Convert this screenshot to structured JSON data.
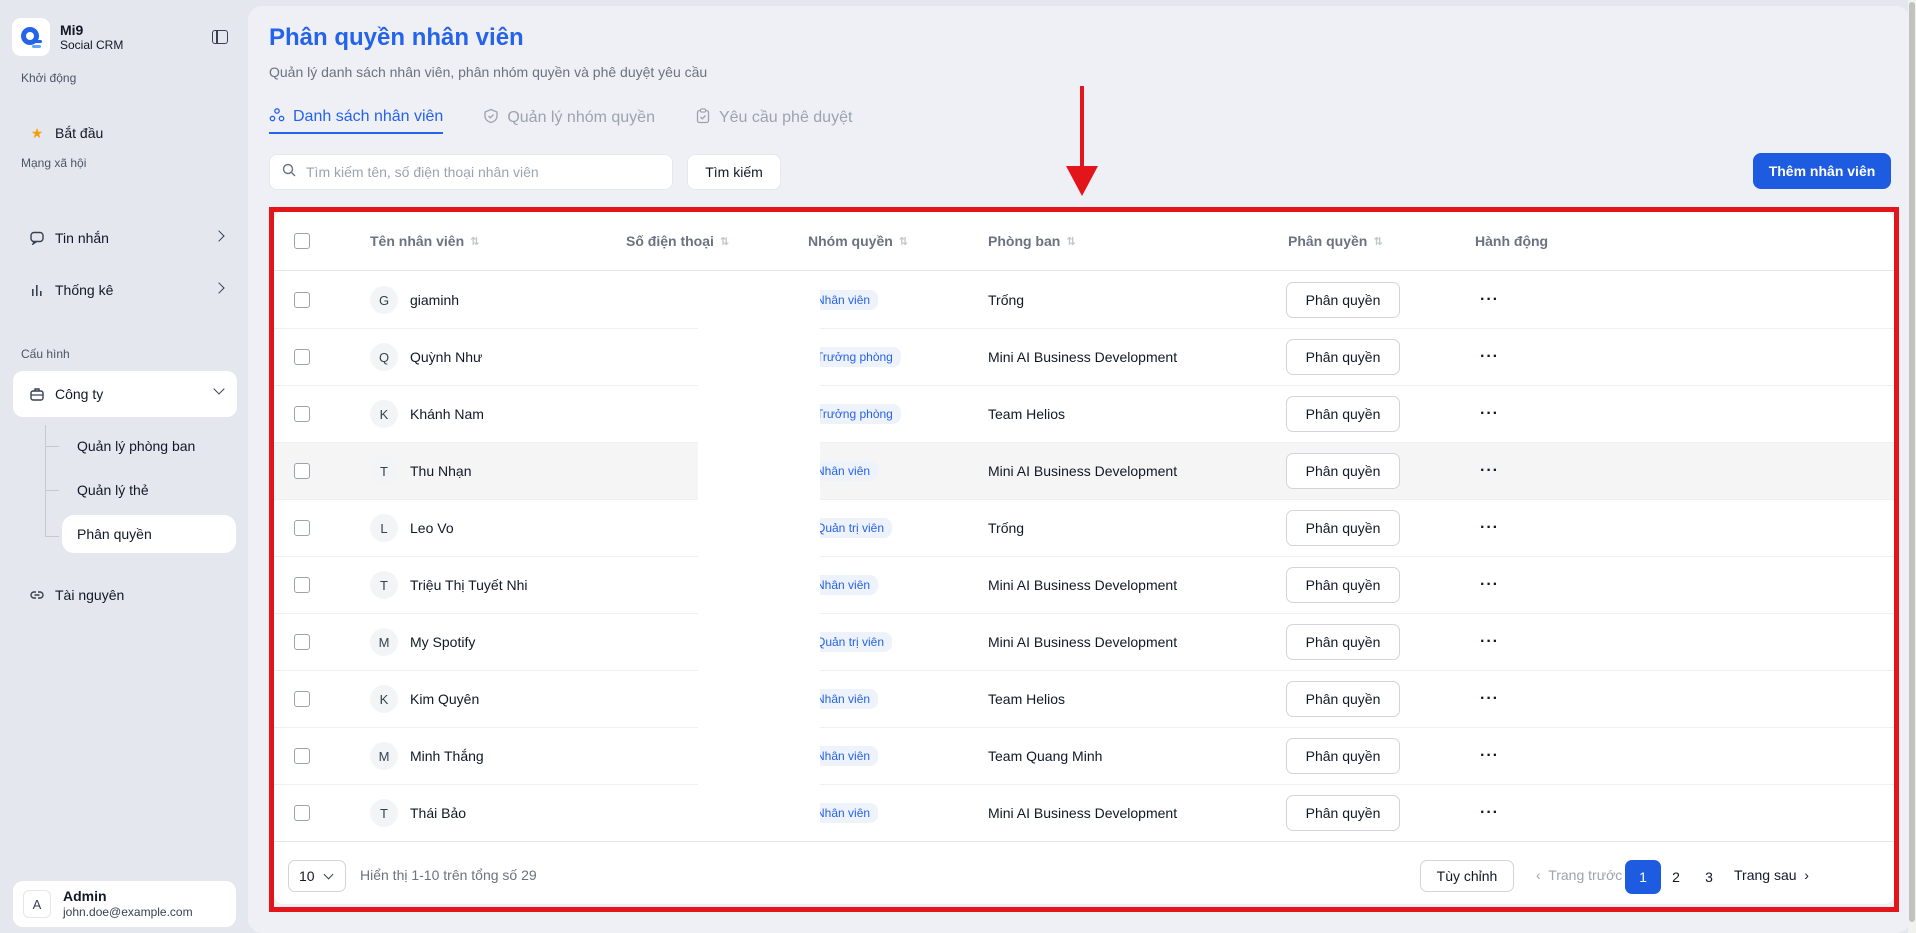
{
  "brand": {
    "name": "Mi9",
    "subtitle": "Social CRM"
  },
  "sidebar": {
    "sections": [
      {
        "label": "Khởi động"
      },
      {
        "label": "Mạng xã hội"
      },
      {
        "label": "Cấu hình"
      }
    ],
    "items": {
      "start": "Bắt đầu",
      "messages": "Tin nhắn",
      "stats": "Thống kê",
      "company": "Công ty",
      "resources": "Tài nguyên"
    },
    "company_sub": [
      "Quản lý phòng ban",
      "Quản lý thẻ",
      "Phân quyền"
    ]
  },
  "user": {
    "initial": "A",
    "name": "Admin",
    "email": "john.doe@example.com"
  },
  "page": {
    "title": "Phân quyền nhân viên",
    "subtitle": "Quản lý danh sách nhân viên, phân nhóm quyền và phê duyệt yêu cầu",
    "tabs": [
      "Danh sách nhân viên",
      "Quản lý nhóm quyền",
      "Yêu cầu phê duyệt"
    ]
  },
  "search": {
    "placeholder": "Tìm kiếm tên, số điện thoại nhân viên",
    "button": "Tìm kiếm"
  },
  "add_button": "Thêm nhân viên",
  "table": {
    "headers": [
      "Tên nhân viên",
      "Số điện thoại",
      "Nhóm quyền",
      "Phòng ban",
      "Phân quyền",
      "Hành động"
    ],
    "rows": [
      {
        "initial": "G",
        "name": "giaminh",
        "role": "Nhân viên",
        "dept": "Trống",
        "perm": "Phân quyền",
        "action": "···"
      },
      {
        "initial": "Q",
        "name": "Quỳnh Như",
        "role": "Trưởng phòng",
        "dept": "Mini AI Business Development",
        "perm": "Phân quyền",
        "action": "···"
      },
      {
        "initial": "K",
        "name": "Khánh Nam",
        "role": "Trưởng phòng",
        "dept": "Team Helios",
        "perm": "Phân quyền",
        "action": "···"
      },
      {
        "initial": "T",
        "name": "Thu Nhạn",
        "role": "Nhân viên",
        "dept": "Mini AI Business Development",
        "perm": "Phân quyền",
        "action": "···"
      },
      {
        "initial": "L",
        "name": "Leo Vo",
        "role": "Quản trị viên",
        "dept": "Trống",
        "perm": "Phân quyền",
        "action": "···"
      },
      {
        "initial": "T",
        "name": "Triệu Thị Tuyết Nhi",
        "role": "Nhân viên",
        "dept": "Mini AI Business Development",
        "perm": "Phân quyền",
        "action": "···"
      },
      {
        "initial": "M",
        "name": "My Spotify",
        "role": "Quản trị viên",
        "dept": "Mini AI Business Development",
        "perm": "Phân quyền",
        "action": "···"
      },
      {
        "initial": "K",
        "name": "Kim Quyên",
        "role": "Nhân viên",
        "dept": "Team Helios",
        "perm": "Phân quyền",
        "action": "···"
      },
      {
        "initial": "M",
        "name": "Minh Thắng",
        "role": "Nhân viên",
        "dept": "Team Quang Minh",
        "perm": "Phân quyền",
        "action": "···"
      },
      {
        "initial": "T",
        "name": "Thái Bảo",
        "role": "Nhân viên",
        "dept": "Mini AI Business Development",
        "perm": "Phân quyền",
        "action": "···"
      }
    ]
  },
  "footer": {
    "page_size": "10",
    "summary": "Hiển thị 1-10 trên tổng số 29",
    "custom": "Tùy chỉnh",
    "prev": "Trang trước",
    "pages": [
      "1",
      "2",
      "3"
    ],
    "next": "Trang sau"
  },
  "colors": {
    "accent": "#2563eb",
    "annotation": "#e3151b"
  }
}
